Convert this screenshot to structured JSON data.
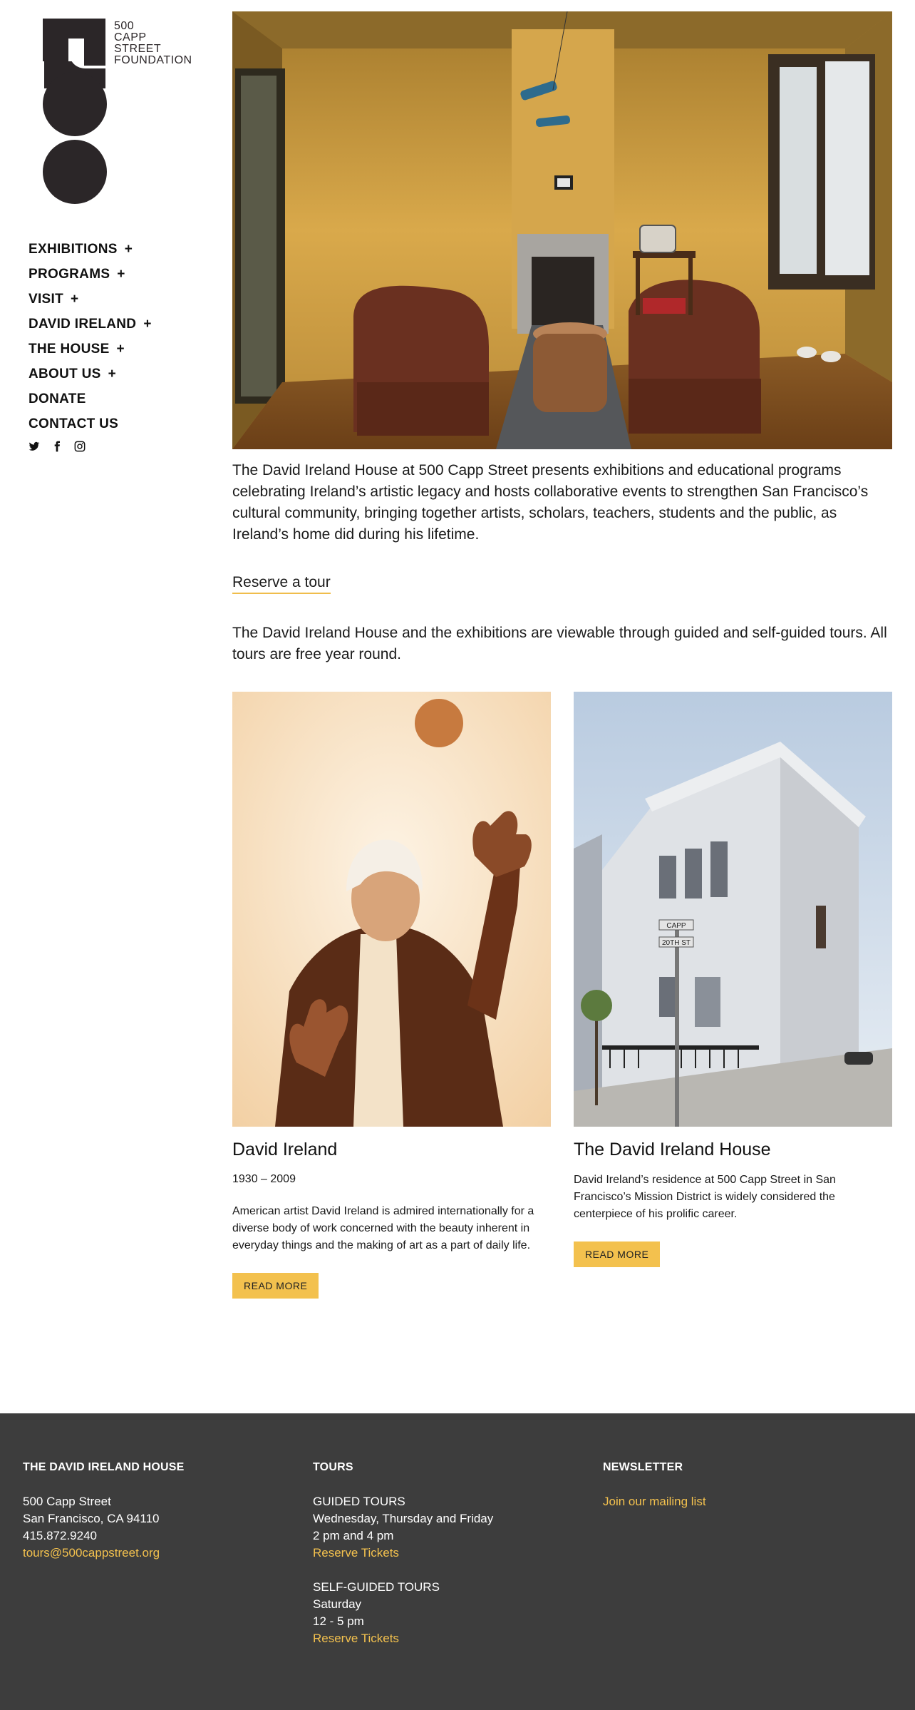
{
  "logo": {
    "lines": [
      "500",
      "CAPP",
      "STREET",
      "FOUNDATION"
    ]
  },
  "nav": [
    {
      "label": "EXHIBITIONS",
      "plus": "+"
    },
    {
      "label": "PROGRAMS",
      "plus": "+"
    },
    {
      "label": "VISIT",
      "plus": "+"
    },
    {
      "label": "DAVID IRELAND",
      "plus": "+"
    },
    {
      "label": "THE HOUSE",
      "plus": "+"
    },
    {
      "label": "ABOUT US",
      "plus": "+"
    },
    {
      "label": "DONATE",
      "plus": ""
    },
    {
      "label": "CONTACT US",
      "plus": ""
    }
  ],
  "social": [
    "twitter-icon",
    "facebook-icon",
    "instagram-icon"
  ],
  "main": {
    "intro": "The David Ireland House at 500 Capp Street presents exhibitions and educational programs celebrating Ireland’s artistic legacy and hosts collaborative events to strengthen San Francisco’s cultural community, bringing together artists, scholars, teachers, students and the public, as Ireland’s home did during his lifetime.",
    "reserve_link": "Reserve a tour",
    "tours_note": "The David Ireland House and the exhibitions are viewable through guided and self-guided tours. All tours are free year round."
  },
  "cards": {
    "left": {
      "title": "David Ireland",
      "dates": "1930 – 2009",
      "desc": "American artist David Ireland is admired internationally for a diverse body of work concerned with the beauty inherent in everyday things and the making of art as a part of daily life.",
      "button": "READ MORE"
    },
    "right": {
      "title": "The David Ireland House",
      "desc": "David Ireland’s residence at 500 Capp Street in San Francisco’s Mission District is widely considered the centerpiece of his prolific career.",
      "button": "READ MORE",
      "sign_top": "CAPP",
      "sign_bottom": "20TH ST"
    }
  },
  "footer": {
    "col1": {
      "heading": "THE DAVID IRELAND HOUSE",
      "address1": "500 Capp Street",
      "address2": "San Francisco, CA 94110",
      "phone": "415.872.9240",
      "email": "tours@500cappstreet.org"
    },
    "col2": {
      "heading": "TOURS",
      "guided_title": "GUIDED TOURS",
      "guided_days": "Wednesday, Thursday and Friday",
      "guided_time": "2 pm and 4 pm",
      "guided_link": "Reserve Tickets",
      "self_title": "SELF-GUIDED TOURS",
      "self_days": "Saturday",
      "self_time": "12 - 5 pm",
      "self_link": "Reserve Tickets"
    },
    "col3": {
      "heading": "NEWSLETTER",
      "link": "Join our mailing list"
    }
  },
  "colors": {
    "accent": "#f3c14e",
    "footer_bg": "#3d3d3d",
    "logo": "#2b2628"
  }
}
